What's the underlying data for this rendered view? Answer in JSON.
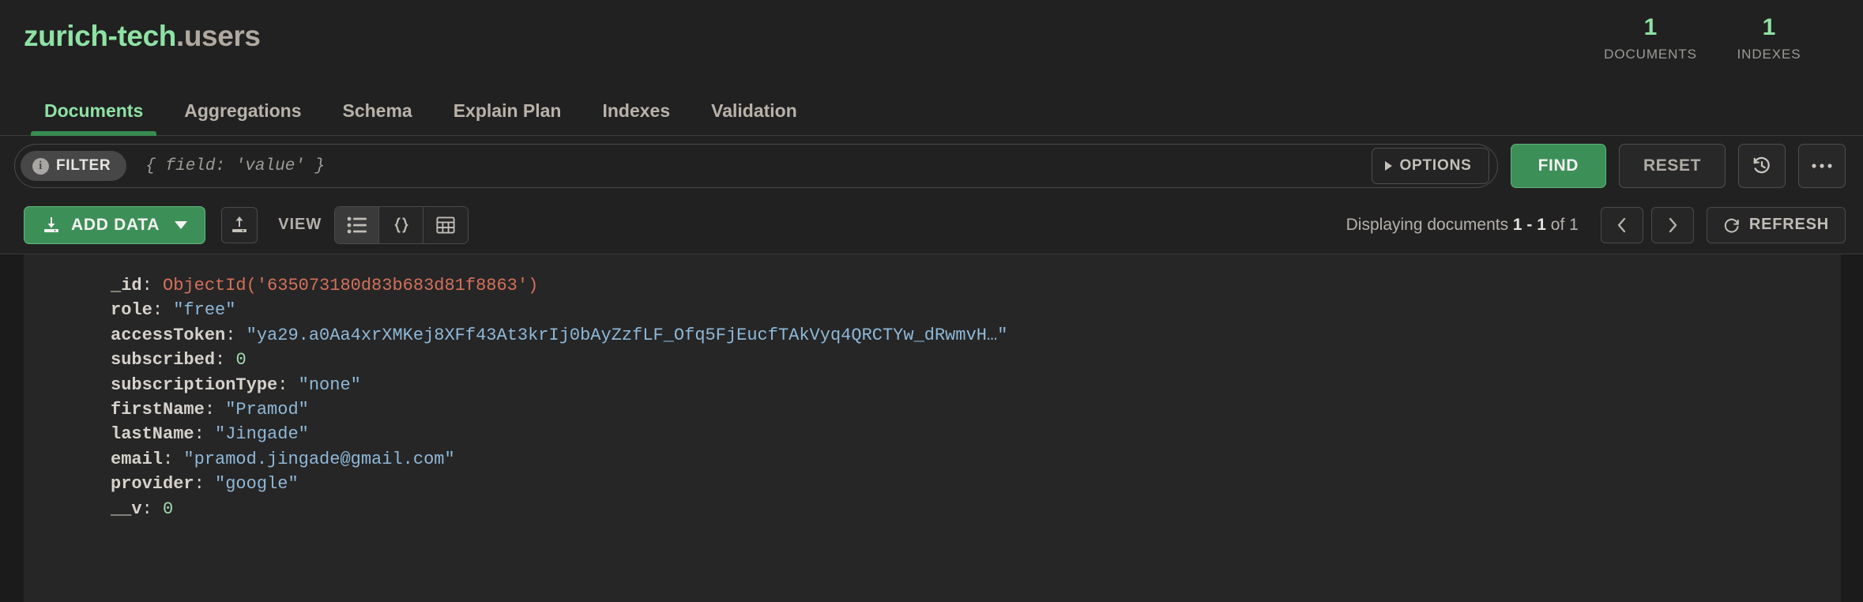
{
  "header": {
    "namespace_db": "zurich-tech",
    "namespace_collection": ".users",
    "stats": [
      {
        "value": "1",
        "label": "DOCUMENTS",
        "name": "documents"
      },
      {
        "value": "1",
        "label": "INDEXES",
        "name": "indexes"
      }
    ]
  },
  "tabs": [
    {
      "label": "Documents",
      "active": true
    },
    {
      "label": "Aggregations",
      "active": false
    },
    {
      "label": "Schema",
      "active": false
    },
    {
      "label": "Explain Plan",
      "active": false
    },
    {
      "label": "Indexes",
      "active": false
    },
    {
      "label": "Validation",
      "active": false
    }
  ],
  "filter_bar": {
    "chip_label": "FILTER",
    "info_icon": "info-icon",
    "input_value": "",
    "input_placeholder": "{ field: 'value' }",
    "options_label": "OPTIONS",
    "find_label": "FIND",
    "reset_label": "RESET",
    "history_icon": "history-icon",
    "more_icon": "ellipsis-icon"
  },
  "toolbar": {
    "add_data_label": "ADD DATA",
    "add_data_icon": "import-download-icon",
    "export_icon": "export-upload-icon",
    "view_label": "VIEW",
    "view_modes": [
      {
        "icon": "list-view-icon",
        "active": true
      },
      {
        "icon": "json-view-icon",
        "active": false
      },
      {
        "icon": "table-view-icon",
        "active": false
      }
    ],
    "displaying_prefix": "Displaying documents ",
    "displaying_range": "1 - 1",
    "displaying_suffix": " of 1",
    "prev_icon": "chevron-left-icon",
    "next_icon": "chevron-right-icon",
    "refresh_label": "REFRESH",
    "refresh_icon": "refresh-icon"
  },
  "document": {
    "fields": [
      {
        "key": "_id",
        "value": "ObjectId('635073180d83b683d81f8863')",
        "type": "objectid"
      },
      {
        "key": "role",
        "value": "\"free\"",
        "type": "string"
      },
      {
        "key": "accessToken",
        "value": "\"ya29.a0Aa4xrXMKej8XFf43At3krIj0bAyZzfLF_Ofq5FjEucfTAkVyq4QRCTYw_dRwmvH…\"",
        "type": "string"
      },
      {
        "key": "subscribed",
        "value": "0",
        "type": "number"
      },
      {
        "key": "subscriptionType",
        "value": "\"none\"",
        "type": "string"
      },
      {
        "key": "firstName",
        "value": "\"Pramod\"",
        "type": "string"
      },
      {
        "key": "lastName",
        "value": "\"Jingade\"",
        "type": "string"
      },
      {
        "key": "email",
        "value": "\"pramod.jingade@gmail.com\"",
        "type": "string"
      },
      {
        "key": "provider",
        "value": "\"google\"",
        "type": "string"
      },
      {
        "key": "__v",
        "value": "0",
        "type": "number"
      }
    ]
  },
  "colors": {
    "accent_green": "#8ee2a4",
    "button_green": "#3d8f58",
    "background": "#212121",
    "doc_background": "#262626",
    "string_blue": "#8fb8d8",
    "number_green": "#9fd9ae",
    "objectid_orange": "#d4705a"
  }
}
